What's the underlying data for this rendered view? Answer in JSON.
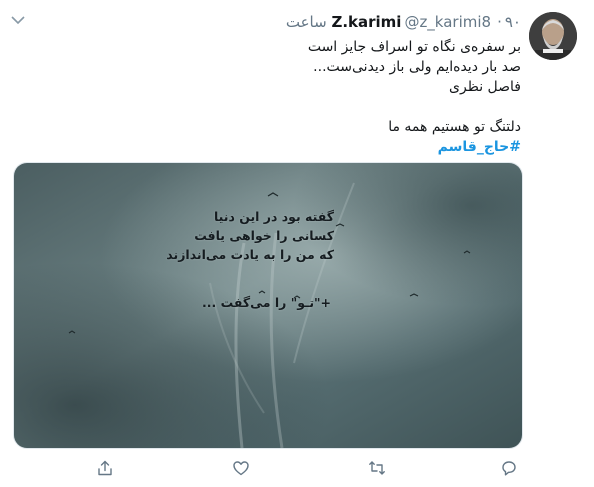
{
  "author": {
    "name": "Z.karimi",
    "handle": "@z_karimi8",
    "separator": "·",
    "time": "۹۰ ساعت"
  },
  "tweet": {
    "lines": [
      "بر سفره‌ی نگاه تو اسراف جایز است",
      "صد بار دیده‌ایم ولی باز دیدنی‌ست...",
      "فاصل نظری"
    ],
    "second_paragraph": "دلتنگ تو هستیم همه ما",
    "hashtag": "#حاج_قاسم"
  },
  "media": {
    "overlay_lines": [
      "گفته بود در این دنیا",
      "کسانی را خواهی یافت",
      "که من را به یادت می‌اندازند",
      "+\"تـو\" را می‌گفت ..."
    ]
  },
  "icons": {
    "avatar": "avatar",
    "more": "chevron-down-icon",
    "reply": "reply-icon",
    "retweet": "retweet-icon",
    "like": "like-icon",
    "share": "share-icon"
  },
  "colors": {
    "name": "#14171a",
    "meta": "#657786",
    "hashtag": "#1b95e0",
    "sky": "#5f7376"
  }
}
